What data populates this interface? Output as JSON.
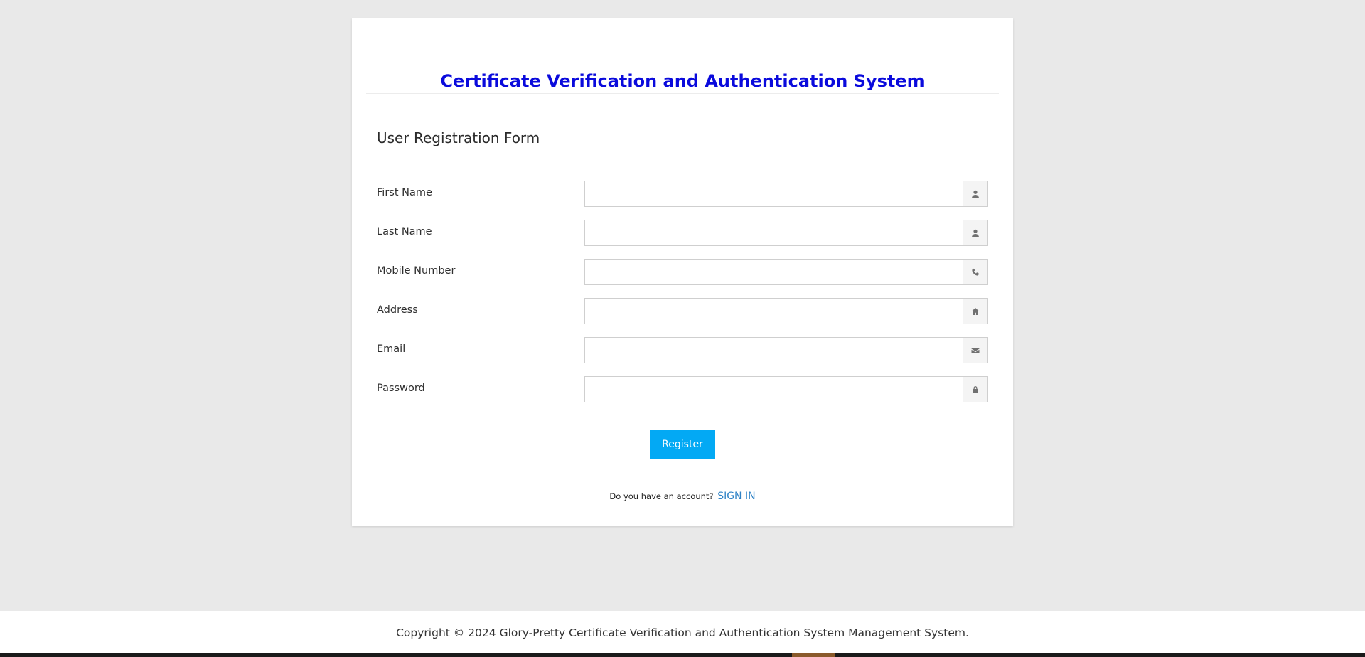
{
  "header": {
    "site_title": "Certificate Verification and Authentication System"
  },
  "form": {
    "heading": "User Registration Form",
    "fields": [
      {
        "label": "First Name",
        "value": "",
        "icon": "user-icon"
      },
      {
        "label": "Last Name",
        "value": "",
        "icon": "user-icon"
      },
      {
        "label": "Mobile Number",
        "value": "",
        "icon": "phone-icon"
      },
      {
        "label": "Address",
        "value": "",
        "icon": "home-icon"
      },
      {
        "label": "Email",
        "value": "",
        "icon": "envelope-icon"
      },
      {
        "label": "Password",
        "value": "",
        "icon": "lock-icon"
      }
    ],
    "register_label": "Register",
    "register_color": "#03a9f4",
    "account_prompt": "Do you have an account?",
    "signin_label": "SIGN IN"
  },
  "footer": {
    "copyright": "Copyright © 2024 Glory-Pretty Certificate Verification and Authentication System Management System."
  },
  "colors": {
    "title": "#0a0adc",
    "link": "#2e82c6",
    "background": "#e9e9e9"
  }
}
